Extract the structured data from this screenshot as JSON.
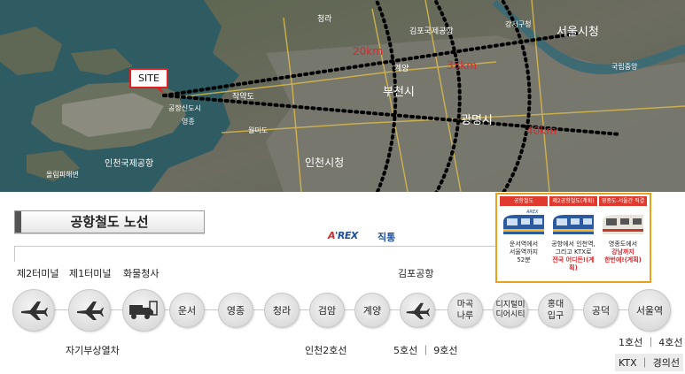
{
  "map": {
    "site_label": "SITE",
    "ring_labels": [
      "20km",
      "35km",
      "40km"
    ],
    "place_labels": [
      {
        "id": "seoul",
        "text": "서울시청"
      },
      {
        "id": "bucheon",
        "text": "부천시"
      },
      {
        "id": "gwangmyeong",
        "text": "광명시"
      },
      {
        "id": "incheon",
        "text": "인천시청"
      },
      {
        "id": "airport",
        "text": "인천국제공항"
      },
      {
        "id": "gimpo",
        "text": "김포국제공항"
      },
      {
        "id": "cheongna",
        "text": "청라"
      },
      {
        "id": "jakyakdo",
        "text": "작약도"
      },
      {
        "id": "gyeyang",
        "text": "계양"
      },
      {
        "id": "ollyeom",
        "text": "올림피해변"
      },
      {
        "id": "incheon_port",
        "text": "공항신도시"
      },
      {
        "id": "yeongjong",
        "text": "영종"
      },
      {
        "id": "wolmido",
        "text": "월미도"
      },
      {
        "id": "gangseo",
        "text": "강서구청"
      },
      {
        "id": "jeonggok",
        "text": "국립중앙"
      }
    ],
    "colors": {
      "ring": "#000000",
      "ring_label": "#e0262a",
      "site_border": "#e02020"
    }
  },
  "route": {
    "title": "공항철도 노선",
    "arex_logo": "AREX",
    "arex_label": "직통",
    "top_labels": [
      "제2터미널",
      "제1터미널",
      "화물청사",
      "김포공항"
    ],
    "stations": [
      {
        "id": "t2",
        "icon": "airplane-icon"
      },
      {
        "id": "t1",
        "icon": "airplane-icon"
      },
      {
        "id": "cargo",
        "icon": "cargo-truck-icon"
      },
      {
        "id": "unseo",
        "label": "운서"
      },
      {
        "id": "yeongjong",
        "label": "영종"
      },
      {
        "id": "cheongna",
        "label": "청라"
      },
      {
        "id": "geomam",
        "label": "검암"
      },
      {
        "id": "gyeyang",
        "label": "계양"
      },
      {
        "id": "gimpo",
        "icon": "airplane-icon"
      },
      {
        "id": "magok",
        "label": "마곡나루"
      },
      {
        "id": "dmc",
        "label": "디지털미디어시티"
      },
      {
        "id": "hongik",
        "label": "홍대입구"
      },
      {
        "id": "gongdeok",
        "label": "공덕"
      },
      {
        "id": "seoul",
        "label": "서울역"
      }
    ],
    "transfers": {
      "maglev": "자기부상열차",
      "incheon2": "인천2호선",
      "gimpo_lines": "5호선 ｜ 9호선",
      "seoul_lines1": "1호선 ｜ 4호선",
      "seoul_lines2": "KTX ｜ 경의선"
    }
  },
  "ad": {
    "panels": [
      {
        "cap": "공항철도",
        "logo": "AREX",
        "t1": "운서역에서",
        "t2": "서울역까지",
        "t3": "52분"
      },
      {
        "cap": "제2공항철도(계획)",
        "t1": "공항에서 인천역,",
        "t2": "그리고 KTX로",
        "t3": "전국 어디든!(계획)"
      },
      {
        "cap": "영종도-서울간 직결(계획)",
        "t1": "영종도에서",
        "t2": "강남까지",
        "t3": "한번에!(계획)"
      }
    ],
    "colors": {
      "border": "#e8a21b",
      "cap": "#e03a2f",
      "highlight": "#e0262a"
    }
  }
}
